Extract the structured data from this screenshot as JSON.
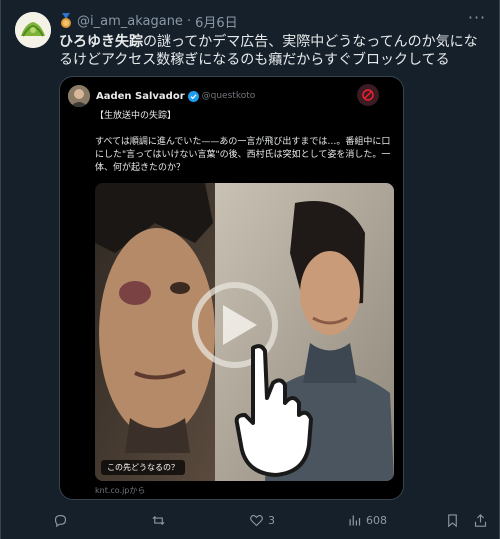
{
  "post": {
    "handle": "@i_am_akagane",
    "separator": "·",
    "date": "6月6日",
    "text_keyword": "ひろゆき失踪",
    "text_rest": "の謎ってかデマ広告、実際中どうなってんのか気になるけどアクセス数稼ぎになるのも癪だからすぐブロックしてる"
  },
  "quote": {
    "author_name": "Aaden Salvador",
    "author_handle": "@questkoto",
    "paragraph_1": "【生放送中の失踪】",
    "paragraph_2": "すべては順調に進んでいた——あの一言が飛び出すまでは…。番組中に口にした\"言ってはいけない言葉\"の後、西村氏は突如として姿を消した。一体、何が起きたのか？",
    "media_caption": "この先どうなるの？",
    "source": "knt.co.jpから"
  },
  "actions": {
    "reply_count": "",
    "retweet_count": "",
    "like_count": "3",
    "views_count": "608"
  },
  "icons": {
    "medal": "medal-icon",
    "more": "more-icon",
    "verified": "verified-icon",
    "blocked": "blocked-icon",
    "play": "play-icon",
    "pointer": "pointer-hand-icon",
    "reply": "reply-icon",
    "retweet": "retweet-icon",
    "like": "like-icon",
    "views": "views-icon",
    "bookmark": "bookmark-icon",
    "share": "share-icon"
  },
  "colors": {
    "background": "#15202b",
    "text": "#e7e9ea",
    "muted": "#8b98a5",
    "border": "#38444d",
    "verified": "#1d9bf0",
    "blocked": "#f4212e"
  }
}
